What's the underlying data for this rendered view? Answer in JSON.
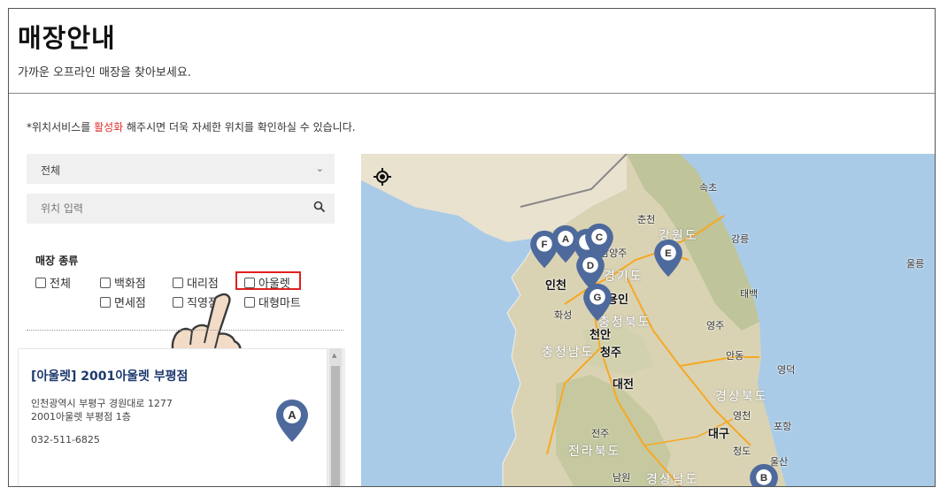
{
  "page": {
    "title": "매장안내",
    "subtitle": "가까운 오프라인 매장을 찾아보세요."
  },
  "notice": {
    "prefix": "*위치서비스를 ",
    "highlight": "활성화",
    "suffix": " 해주시면 더욱 자세한 위치를 확인하실 수 있습니다."
  },
  "region_select": {
    "value": "전체"
  },
  "search": {
    "placeholder": "위치 입력"
  },
  "store_types": {
    "title": "매장 종류",
    "options": [
      "전체",
      "백화점",
      "대리점",
      "아울렛",
      "면세점",
      "직영점",
      "대형마트"
    ],
    "highlighted": "아울렛"
  },
  "store_list": [
    {
      "name": "[아울렛] 2001아울렛 부평점",
      "address_line1": "인천광역시 부평구 경원대로 1277",
      "address_line2": "2001아울렛 부평점 1층",
      "phone": "032-511-6825",
      "marker": "A"
    }
  ],
  "map": {
    "markers": [
      "F",
      "A",
      "C",
      "D",
      "E",
      "G",
      "B"
    ],
    "labels": {
      "sokcho": "속초",
      "chuncheon": "춘천",
      "gangwon": "강원도",
      "gangneung": "강릉",
      "ulleung": "울릉",
      "namyangju": "남양주",
      "gyeonggi": "경기도",
      "incheon": "인천",
      "yongin": "용인",
      "taebaek": "태백",
      "hwaseong": "화성",
      "chungbuk": "충청북도",
      "yeongju": "영주",
      "cheonan": "천안",
      "chungnam": "충청남도",
      "cheongju": "청주",
      "andong": "안동",
      "yeongdeok": "영덕",
      "daejeon": "대전",
      "gyeongbuk": "경상북도",
      "yeongcheon": "영천",
      "pohang": "포항",
      "jeonju": "전주",
      "daegu": "대구",
      "jeonbuk": "전라북도",
      "cheongdo": "청도",
      "ulsan": "울산",
      "namwon": "남원",
      "gyeongnam": "경상남도"
    }
  },
  "colors": {
    "accent_red": "#e02020",
    "store_name": "#1e3a6e",
    "marker": "#4e6a9c"
  },
  "icons": [
    "chevron-down-icon",
    "search-icon",
    "my-location-icon",
    "hand-pointer-icon",
    "map-marker-icon"
  ]
}
